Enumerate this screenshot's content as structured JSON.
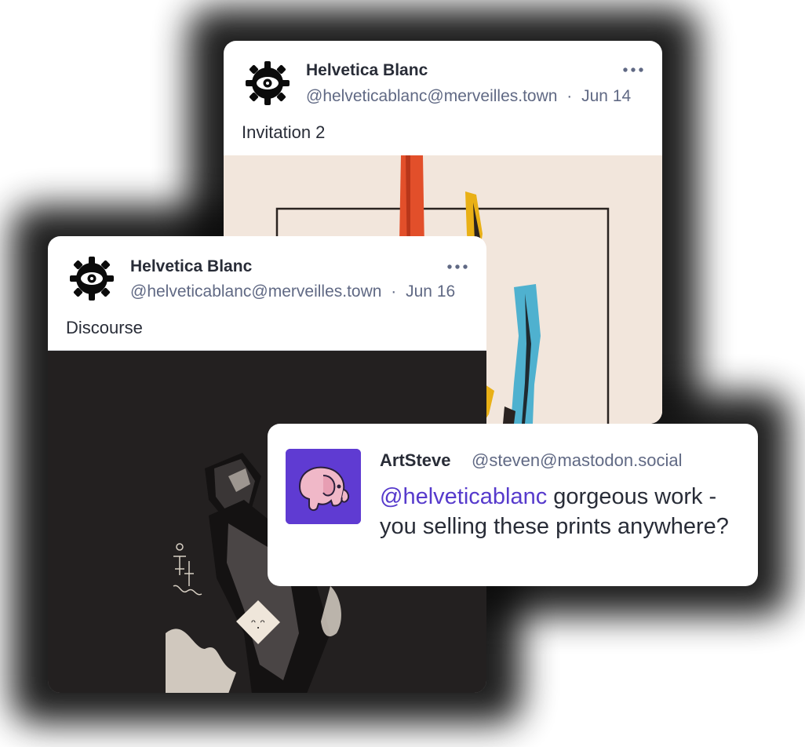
{
  "posts": [
    {
      "author": "Helvetica Blanc",
      "handle": "@helveticablanc@merveilles.town",
      "date": "Jun 14",
      "text": "Invitation 2",
      "more": "•••",
      "image": "abstract-painting"
    },
    {
      "author": "Helvetica Blanc",
      "handle": "@helveticablanc@merveilles.town",
      "date": "Jun 16",
      "text": "Discourse",
      "more": "•••",
      "image": "dark-illustration"
    }
  ],
  "reply": {
    "author": "ArtSteve",
    "handle": "@steven@mastodon.social",
    "mention": "@helveticablanc",
    "text": " gorgeous work - you selling these prints anywhere?",
    "avatar_icon": "elephant-icon"
  },
  "separator": "·",
  "colors": {
    "text": "#282c37",
    "muted": "#606984",
    "mention": "#563acc",
    "avatar_bg": "#5f3bd2",
    "shadow": "#0c0c0c"
  }
}
